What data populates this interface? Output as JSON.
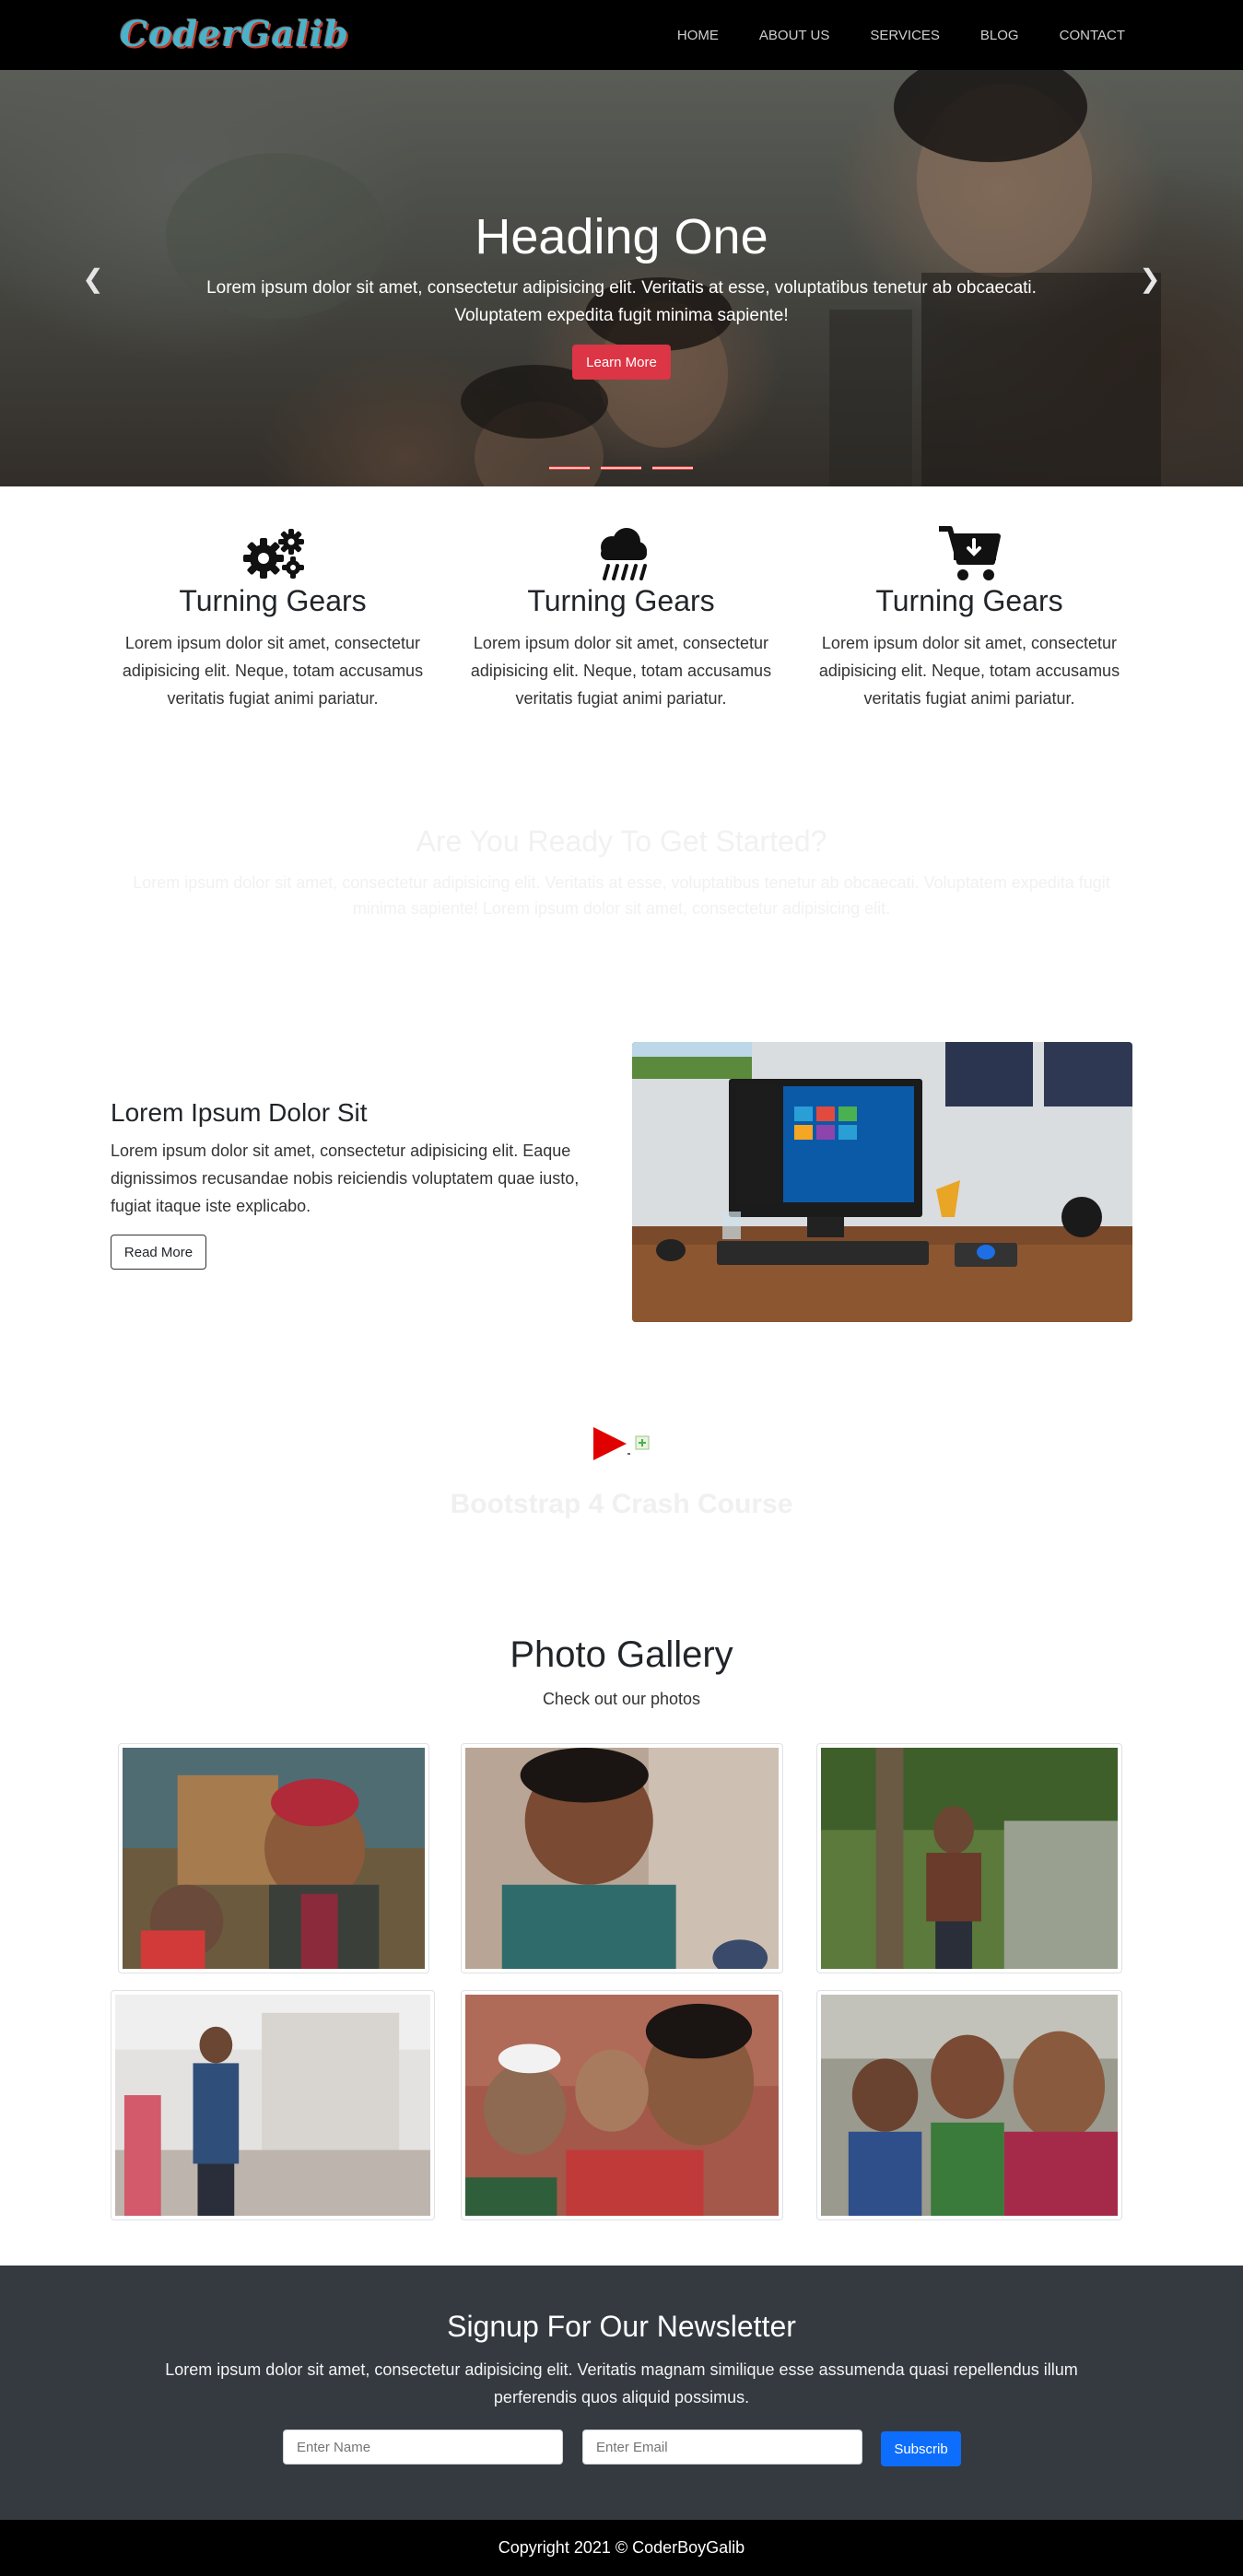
{
  "nav": {
    "brand": "CoderGalib",
    "links": [
      "HOME",
      "ABOUT US",
      "SERVICES",
      "BLOG",
      "CONTACT"
    ]
  },
  "hero": {
    "heading": "Heading One",
    "text": "Lorem ipsum dolor sit amet, consectetur adipisicing elit. Veritatis at esse, voluptatibus tenetur ab obcaecati. Voluptatem expedita fugit minima sapiente!",
    "button": "Learn More",
    "prev_icon": "chevron-left-icon",
    "next_icon": "chevron-right-icon",
    "slides": 3
  },
  "features": [
    {
      "icon": "gears-icon",
      "title": "Turning Gears",
      "text": "Lorem ipsum dolor sit amet, consectetur adipisicing elit. Neque, totam accusamus veritatis fugiat animi pariatur."
    },
    {
      "icon": "cloud-rain-icon",
      "title": "Turning Gears",
      "text": "Lorem ipsum dolor sit amet, consectetur adipisicing elit. Neque, totam accusamus veritatis fugiat animi pariatur."
    },
    {
      "icon": "cart-download-icon",
      "title": "Turning Gears",
      "text": "Lorem ipsum dolor sit amet, consectetur adipisicing elit. Neque, totam accusamus veritatis fugiat animi pariatur."
    }
  ],
  "started": {
    "title": "Are You Ready To Get Started?",
    "text": "Lorem ipsum dolor sit amet, consectetur adipisicing elit. Veritatis at esse, voluptatibus tenetur ab obcaecati. Voluptatem expedita fugit minima sapiente! Lorem ipsum dolor sit amet, consectetur adipisicing elit."
  },
  "info": {
    "title": "Lorem Ipsum Dolor Sit",
    "text": "Lorem ipsum dolor sit amet, consectetur adipisicing elit. Eaque dignissimos recusandae nobis reiciendis voluptatem quae iusto, fugiat itaque iste explicabo.",
    "button": "Read More"
  },
  "video": {
    "title": "Bootstrap 4 Crash Course",
    "icon": "play-icon"
  },
  "gallery": {
    "title": "Photo Gallery",
    "subtitle": "Check out our photos"
  },
  "newsletter": {
    "title": "Signup For Our Newsletter",
    "text": "Lorem ipsum dolor sit amet, consectetur adipisicing elit. Veritatis magnam similique esse assumenda quasi repellendus illum perferendis quos aliquid possimus.",
    "name_placeholder": "Enter Name",
    "email_placeholder": "Enter Email",
    "button": "Subscrib"
  },
  "footer": {
    "text": "Copyright 2021 © CoderBoyGalib"
  },
  "colors": {
    "accent": "#dc3545",
    "primary": "#0d6efd",
    "newsletter_bg": "#343a40"
  }
}
